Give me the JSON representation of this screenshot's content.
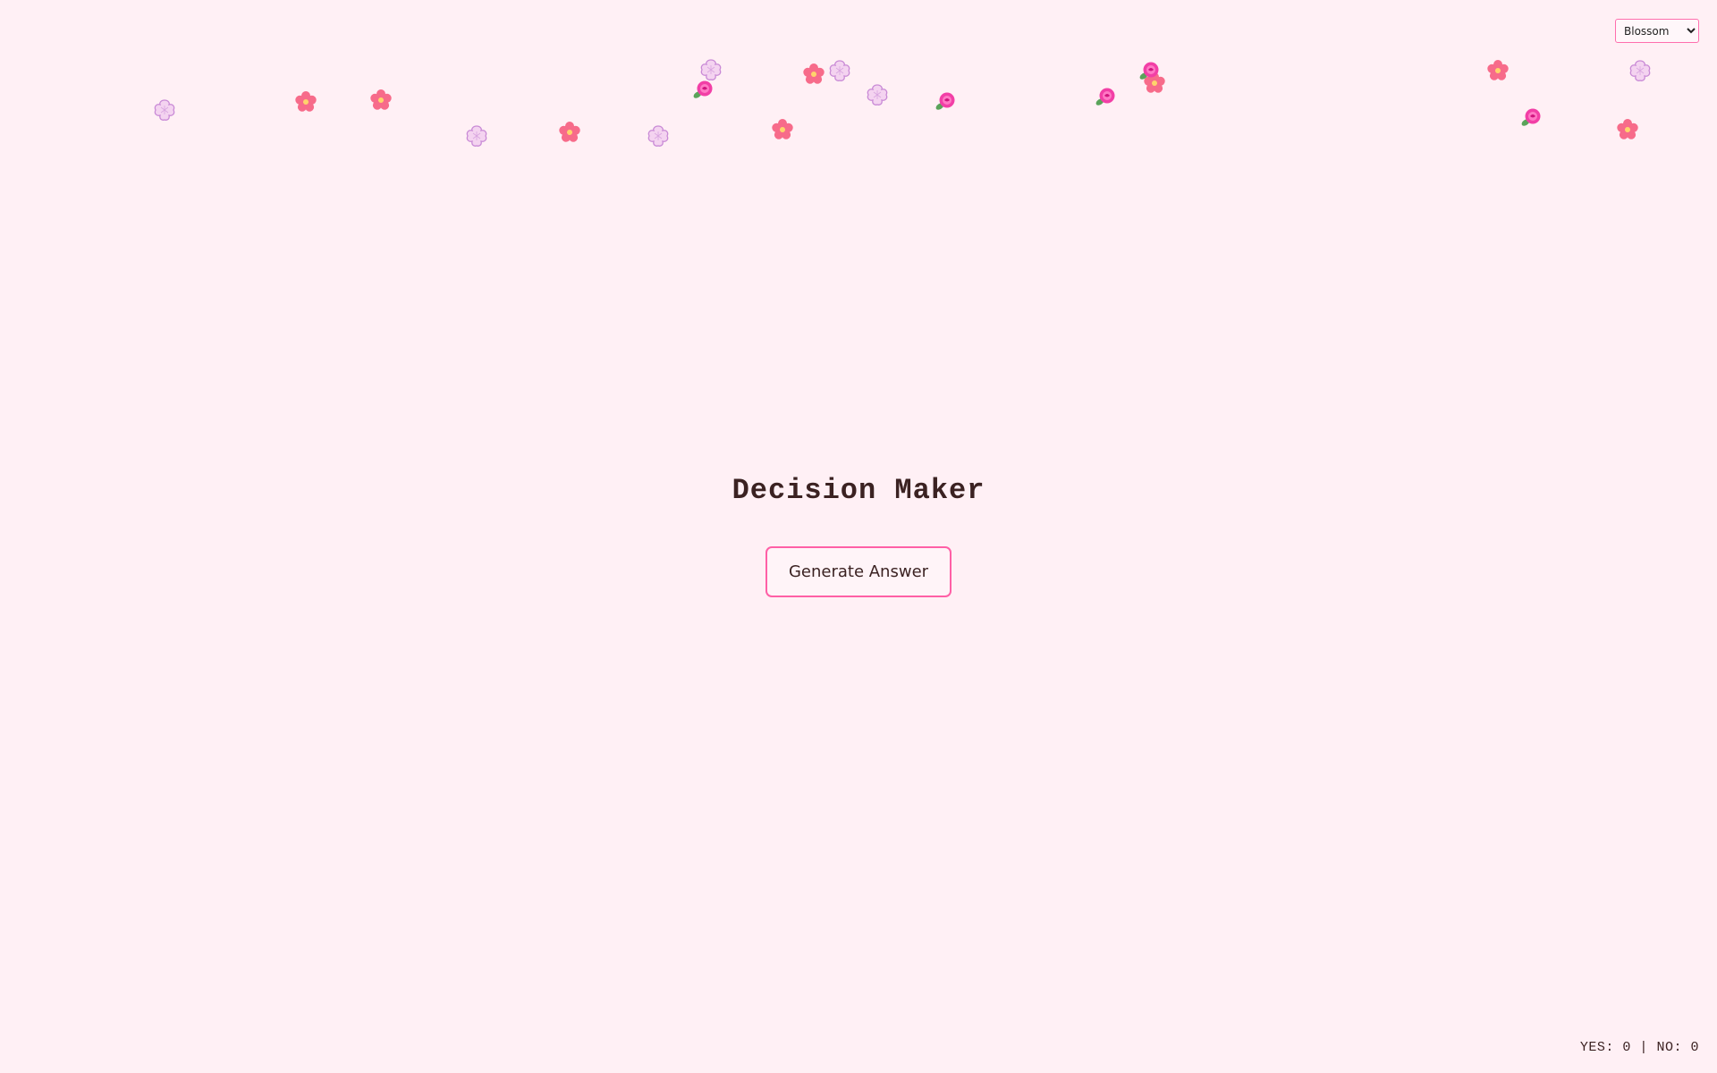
{
  "theme_select": {
    "selected": "Blossom",
    "options": [
      "Blossom"
    ]
  },
  "page_title": "Decision Maker",
  "generate_button_label": "Generate Answer",
  "score": {
    "yes_label": "YES:",
    "yes_count": "0",
    "separator": "|",
    "no_label": "NO:",
    "no_count": "0"
  },
  "colors": {
    "background": "#fff0f5",
    "accent": "#ff5fa6",
    "text": "#3b2222"
  },
  "decorations": {
    "petal_types": [
      "pink-blossom-icon",
      "lavender-blossom-icon",
      "magenta-rose-icon"
    ]
  }
}
